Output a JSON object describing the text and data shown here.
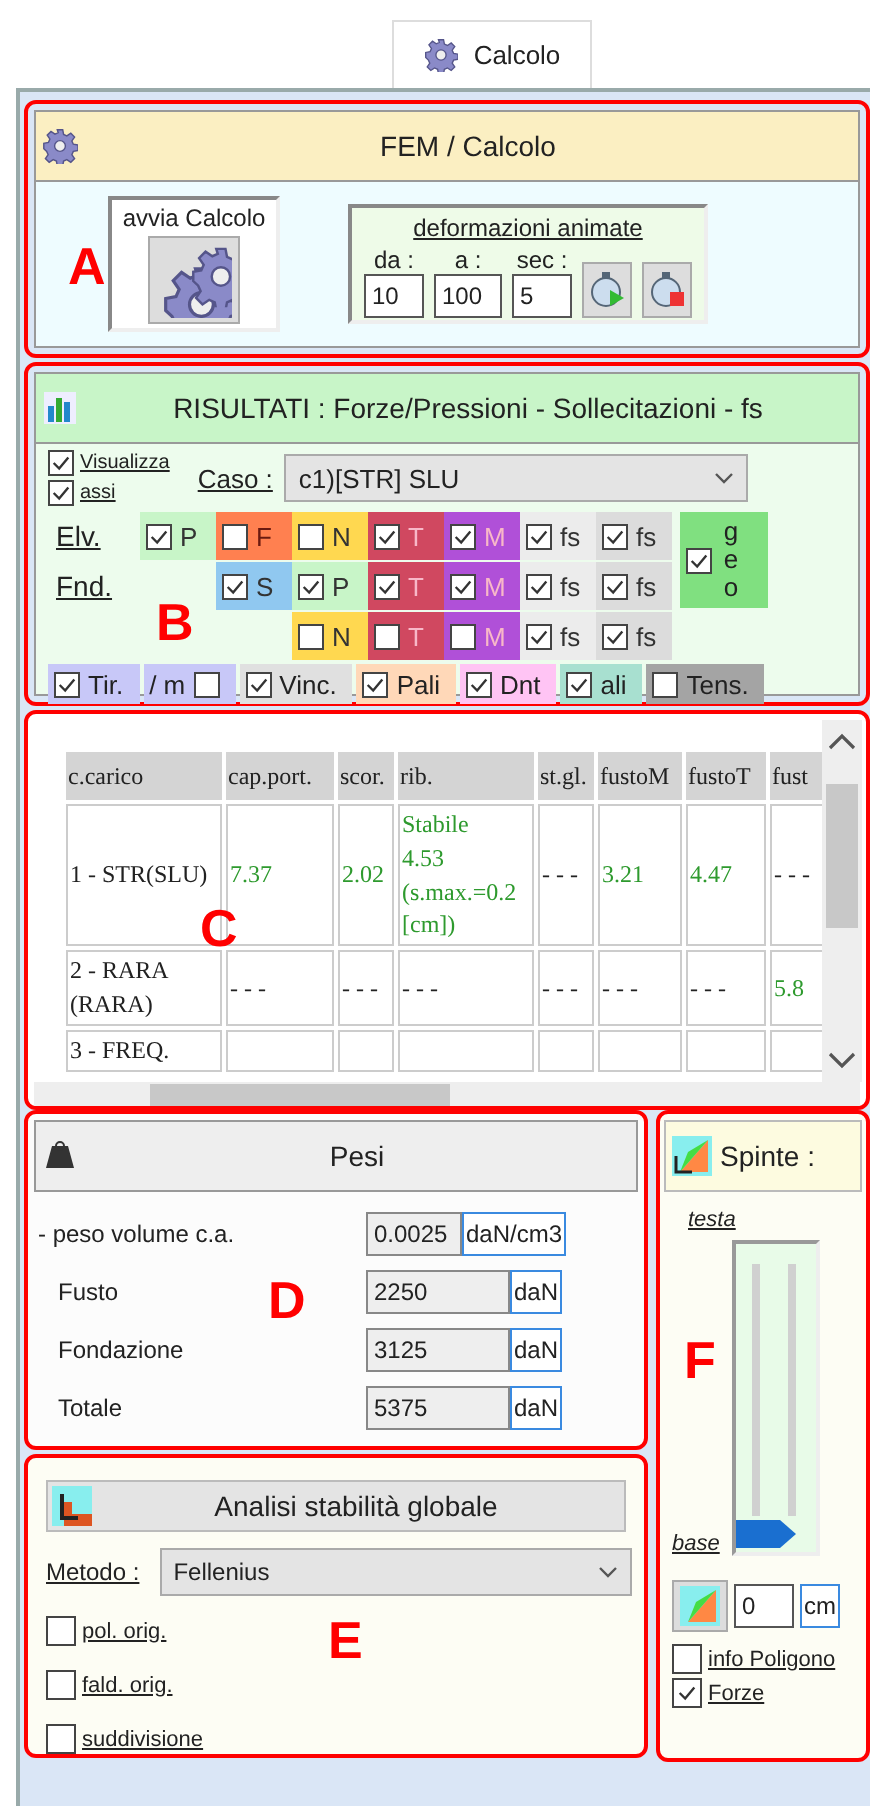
{
  "tab": {
    "label": "Calcolo",
    "selected": true
  },
  "fem": {
    "marker": "A",
    "title": "FEM / Calcolo",
    "run_button": "avvia Calcolo",
    "animation": {
      "title": "deformazioni animate",
      "fields": [
        {
          "label": "da :",
          "value": "10"
        },
        {
          "label": "a :",
          "value": "100"
        },
        {
          "label": "sec :",
          "value": "5"
        }
      ]
    }
  },
  "results": {
    "marker": "B",
    "title": "RISULTATI : Forze/Pressioni - Sollecitazioni - fs",
    "display_options": [
      {
        "label": "Visualizza",
        "checked": true
      },
      {
        "label": "assi",
        "checked": true
      }
    ],
    "case": {
      "label": "Caso :",
      "value": "c1)[STR] SLU"
    },
    "grid": [
      {
        "label": "Elv.",
        "cells": [
          {
            "label": "P",
            "checked": true,
            "color": "#c8f5c8"
          },
          {
            "label": "F",
            "checked": false,
            "color": "#ff8050"
          },
          {
            "label": "N",
            "checked": false,
            "color": "#ffd850"
          },
          {
            "label": "T",
            "checked": true,
            "color": "#d04860"
          },
          {
            "label": "M",
            "checked": true,
            "color": "#b050d8"
          },
          {
            "label": "fs",
            "checked": true,
            "color": "#ececec"
          },
          {
            "label": "fs",
            "checked": true,
            "color": "#dcdcdc"
          }
        ]
      },
      {
        "label": "Fnd.",
        "cells": [
          null,
          {
            "label": "S",
            "checked": true,
            "color": "#90c8f0"
          },
          {
            "label": "P",
            "checked": true,
            "color": "#c8f5c8"
          },
          {
            "label": "T",
            "checked": true,
            "color": "#d04860"
          },
          {
            "label": "M",
            "checked": true,
            "color": "#b050d8"
          },
          {
            "label": "fs",
            "checked": true,
            "color": "#ececec"
          },
          {
            "label": "fs",
            "checked": true,
            "color": "#dcdcdc"
          }
        ]
      },
      {
        "cells": [
          null,
          null,
          {
            "label": "N",
            "checked": false,
            "color": "#ffd850"
          },
          {
            "label": "T",
            "checked": false,
            "color": "#d04860"
          },
          {
            "label": "M",
            "checked": false,
            "color": "#b050d8"
          },
          {
            "label": "fs",
            "checked": true,
            "color": "#ececec"
          },
          {
            "label": "fs",
            "checked": true,
            "color": "#dcdcdc"
          }
        ]
      }
    ],
    "geo": {
      "label": "geo",
      "checked": true
    },
    "toggles": [
      {
        "label": "Tir.",
        "checked": true,
        "color": "#c8c8f8",
        "kind": "leading"
      },
      {
        "label": "/ m",
        "checked": false,
        "color": "#c8c8f8",
        "kind": "trailing"
      },
      {
        "label": "Vinc.",
        "checked": true,
        "color": "#e0e0e0",
        "kind": "leading"
      },
      {
        "label": "Pali",
        "checked": true,
        "color": "#ffd8b8",
        "kind": "leading"
      },
      {
        "label": "Dnt",
        "checked": true,
        "color": "#ffc4f4",
        "kind": "leading"
      },
      {
        "label": "ali",
        "checked": true,
        "color": "#a8e0d0",
        "kind": "leading"
      },
      {
        "label": "Tens.",
        "checked": false,
        "color": "#a4a4a4",
        "kind": "leading"
      }
    ]
  },
  "table": {
    "marker": "C",
    "columns": [
      "c.carico",
      "cap.port.",
      "scor.",
      "rib.",
      "st.gl.",
      "fustoM",
      "fustoT",
      "fust"
    ],
    "rows": [
      [
        {
          "text": "1 - STR(SLU)"
        },
        {
          "text": "7.37",
          "color": "#2e9a2e"
        },
        {
          "text": "2.02",
          "color": "#2e9a2e"
        },
        {
          "text": "Stabile\n4.53\n(s.max.=0.2\n[cm])",
          "color": "#2e9a2e"
        },
        {
          "text": "- - -"
        },
        {
          "text": "3.21",
          "color": "#2e9a2e"
        },
        {
          "text": "4.47",
          "color": "#2e9a2e"
        },
        {
          "text": "- - -"
        }
      ],
      [
        {
          "text": "2 - RARA\n(RARA)"
        },
        {
          "text": "- - -"
        },
        {
          "text": "- - -"
        },
        {
          "text": "- - -"
        },
        {
          "text": "- - -"
        },
        {
          "text": "- - -"
        },
        {
          "text": "- - -"
        },
        {
          "text": "5.8",
          "color": "#2e9a2e"
        }
      ],
      [
        {
          "text": "3 - FREQ."
        },
        null,
        null,
        null,
        null,
        null,
        null,
        null
      ]
    ]
  },
  "weights": {
    "marker": "D",
    "title": "Pesi",
    "rows": [
      {
        "label": "- peso volume c.a.",
        "value": "0.0025",
        "unit": "daN/cm3"
      },
      {
        "label": "Fusto",
        "value": "2250",
        "unit": "daN"
      },
      {
        "label": "Fondazione",
        "value": "3125",
        "unit": "daN"
      },
      {
        "label": "Totale",
        "value": "5375",
        "unit": "daN"
      }
    ]
  },
  "stability": {
    "marker": "E",
    "button": "Analisi stabilità globale",
    "method": {
      "label": "Metodo :",
      "value": "Fellenius"
    },
    "options": [
      {
        "label": "pol. orig.",
        "checked": false
      },
      {
        "label": "fald. orig.",
        "checked": false
      },
      {
        "label": "suddivisione",
        "checked": false
      }
    ]
  },
  "thrusts": {
    "marker": "F",
    "title": "Spinte :",
    "top_label": "testa",
    "bottom_label": "base",
    "slider": {
      "level": 0
    },
    "offset": {
      "value": "0",
      "unit": "cm"
    },
    "options": [
      {
        "label": "info Poligono",
        "checked": false
      },
      {
        "label": "Forze",
        "checked": true
      }
    ]
  }
}
